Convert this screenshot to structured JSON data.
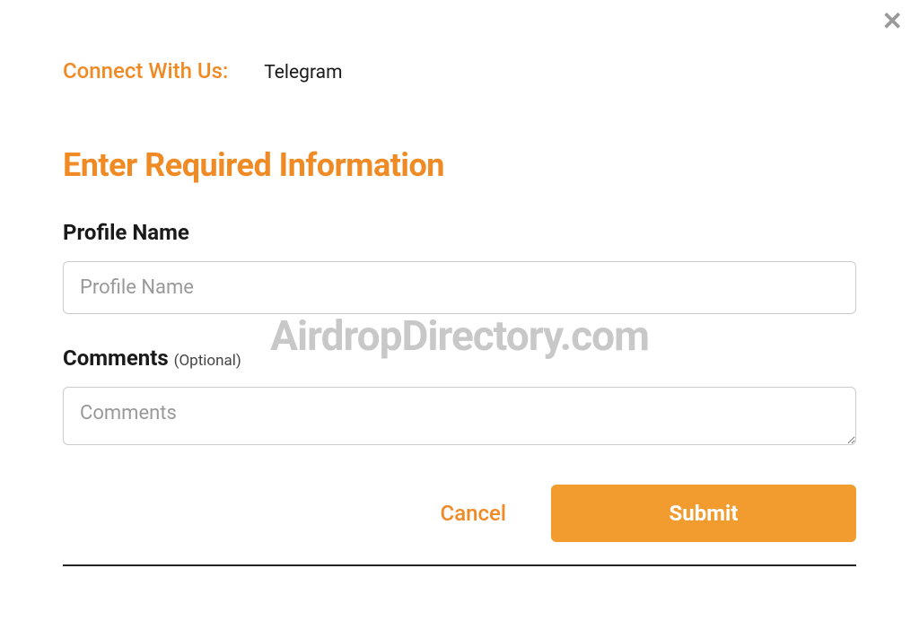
{
  "close_icon": "✕",
  "connect": {
    "label": "Connect With Us:",
    "link": "Telegram"
  },
  "heading": "Enter Required Information",
  "fields": {
    "profile_name": {
      "label": "Profile Name",
      "placeholder": "Profile Name"
    },
    "comments": {
      "label": "Comments",
      "optional": "(Optional)",
      "placeholder": "Comments"
    }
  },
  "buttons": {
    "cancel": "Cancel",
    "submit": "Submit"
  },
  "watermark": "AirdropDirectory.com"
}
